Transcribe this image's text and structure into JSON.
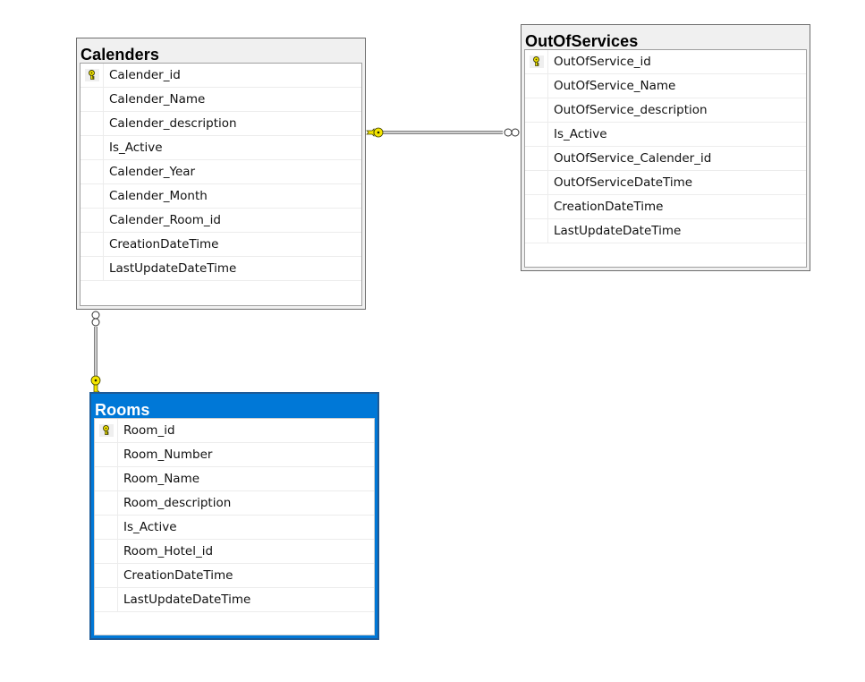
{
  "diagram": {
    "tables": [
      {
        "id": "calenders",
        "title": "Calenders",
        "selected": false,
        "columns": [
          {
            "name": "Calender_id",
            "primary_key": true
          },
          {
            "name": "Calender_Name",
            "primary_key": false
          },
          {
            "name": "Calender_description",
            "primary_key": false
          },
          {
            "name": "Is_Active",
            "primary_key": false
          },
          {
            "name": "Calender_Year",
            "primary_key": false
          },
          {
            "name": "Calender_Month",
            "primary_key": false
          },
          {
            "name": "Calender_Room_id",
            "primary_key": false
          },
          {
            "name": "CreationDateTime",
            "primary_key": false
          },
          {
            "name": "LastUpdateDateTime",
            "primary_key": false
          }
        ]
      },
      {
        "id": "outofservices",
        "title": "OutOfServices",
        "selected": false,
        "columns": [
          {
            "name": "OutOfService_id",
            "primary_key": true
          },
          {
            "name": "OutOfService_Name",
            "primary_key": false
          },
          {
            "name": "OutOfService_description",
            "primary_key": false
          },
          {
            "name": "Is_Active",
            "primary_key": false
          },
          {
            "name": "OutOfService_Calender_id",
            "primary_key": false
          },
          {
            "name": "OutOfServiceDateTime",
            "primary_key": false
          },
          {
            "name": "CreationDateTime",
            "primary_key": false
          },
          {
            "name": "LastUpdateDateTime",
            "primary_key": false
          }
        ]
      },
      {
        "id": "rooms",
        "title": "Rooms",
        "selected": true,
        "columns": [
          {
            "name": "Room_id",
            "primary_key": true
          },
          {
            "name": "Room_Number",
            "primary_key": false
          },
          {
            "name": "Room_Name",
            "primary_key": false
          },
          {
            "name": "Room_description",
            "primary_key": false
          },
          {
            "name": "Is_Active",
            "primary_key": false
          },
          {
            "name": "Room_Hotel_id",
            "primary_key": false
          },
          {
            "name": "CreationDateTime",
            "primary_key": false
          },
          {
            "name": "LastUpdateDateTime",
            "primary_key": false
          }
        ]
      }
    ],
    "relationships": [
      {
        "one_side": "calenders",
        "many_side": "outofservices",
        "one_end": "key-icon",
        "many_end": "infinity-icon"
      },
      {
        "one_side": "rooms",
        "many_side": "calenders",
        "one_end": "key-icon",
        "many_end": "infinity-icon"
      }
    ],
    "colors": {
      "selected_header": "#0078d7",
      "key_icon": "#f5e600",
      "table_header": "#f0f0f0"
    }
  }
}
